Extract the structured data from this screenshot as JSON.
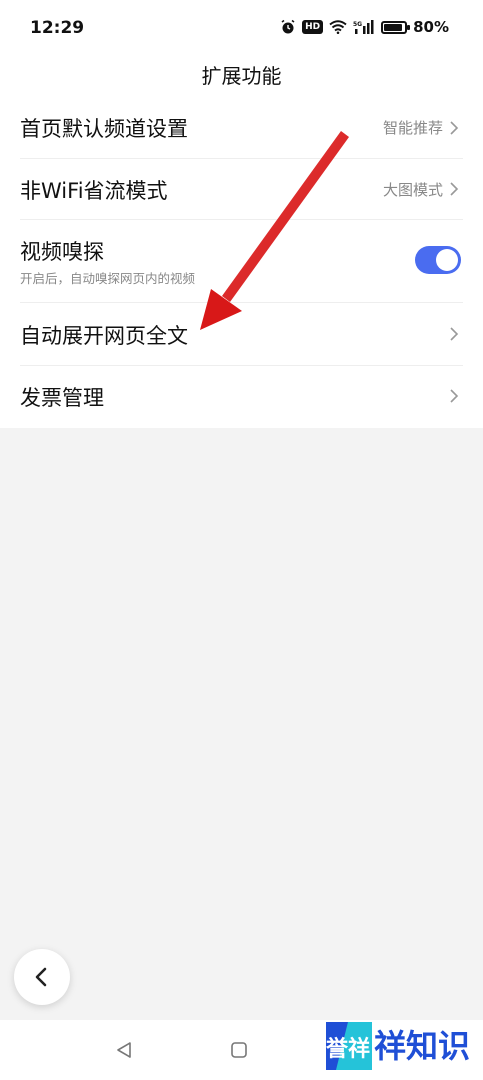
{
  "status_bar": {
    "time": "12:29",
    "hd_badge": "HD",
    "battery_text": "80%",
    "battery_level": 0.8,
    "icons": [
      "alarm-icon",
      "hd-icon",
      "wifi-icon",
      "5g-signal-icon",
      "battery-icon"
    ]
  },
  "header": {
    "title": "扩展功能"
  },
  "settings": {
    "homepage_channel": {
      "label": "首页默认频道设置",
      "value": "智能推荐"
    },
    "wifi_saving": {
      "label": "非WiFi省流模式",
      "value": "大图模式"
    },
    "video_sniff": {
      "label": "视频嗅探",
      "description": "开启后，自动嗅探网页内的视频",
      "enabled": true
    },
    "auto_expand": {
      "label": "自动展开网页全文"
    },
    "invoice": {
      "label": "发票管理"
    }
  },
  "colors": {
    "accent": "#4a6cf0",
    "annotation_arrow": "#e02020",
    "watermark": "#1f4fd6"
  },
  "watermark": {
    "logo_text": "誉祥",
    "text": "祥知识"
  }
}
